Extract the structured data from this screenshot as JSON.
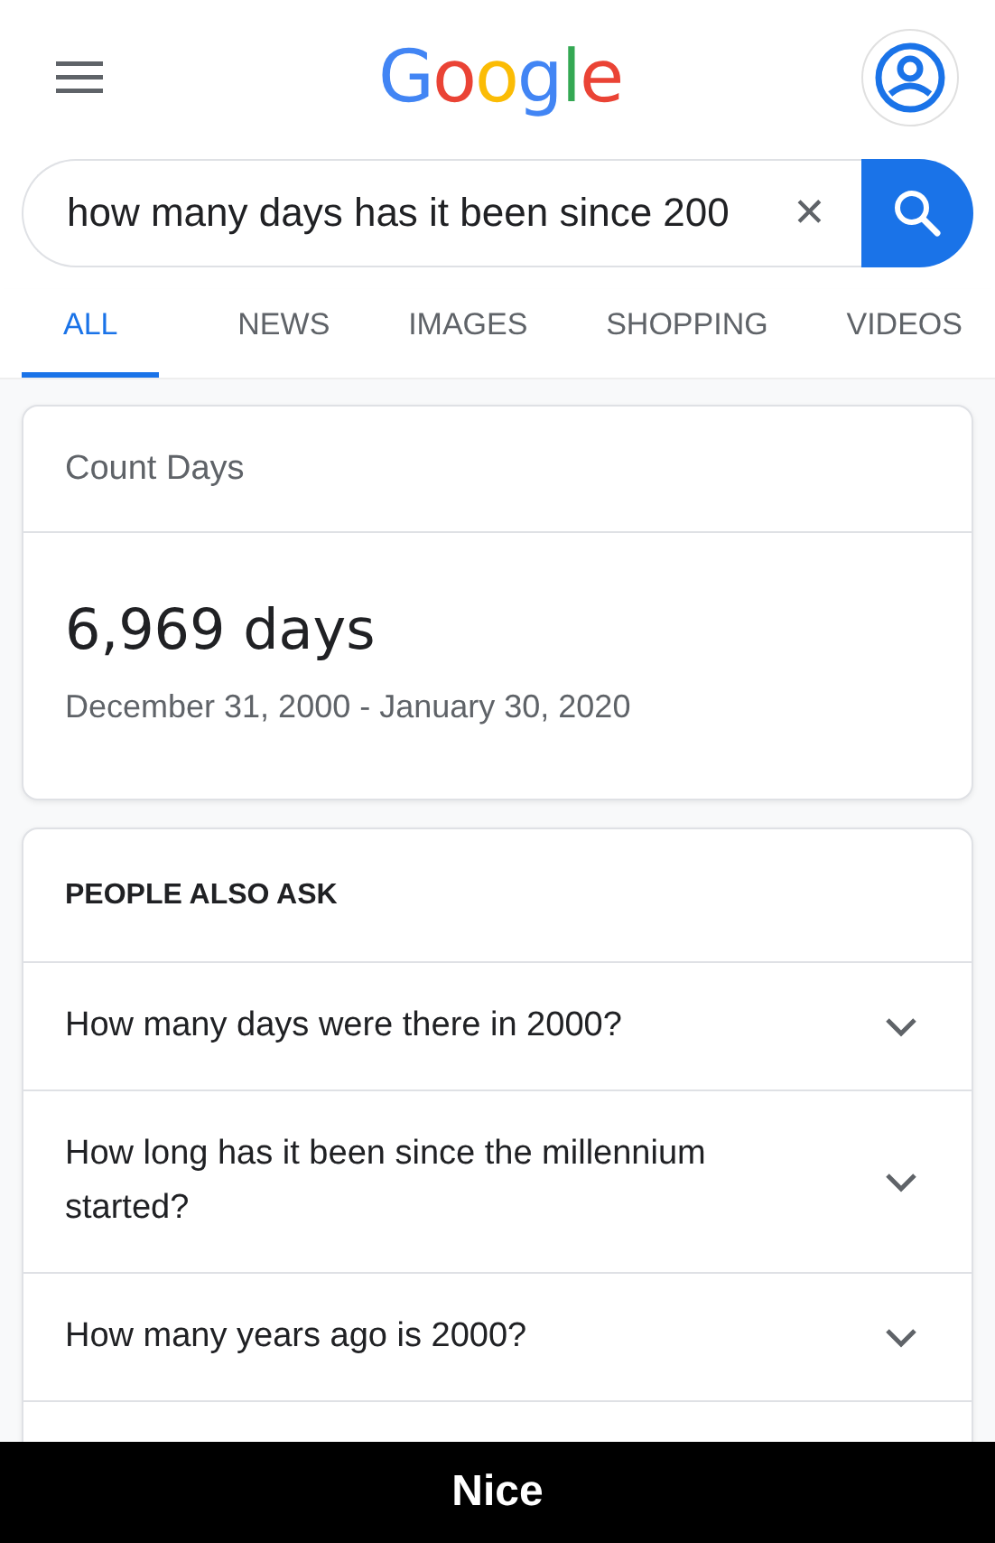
{
  "header": {
    "logo": "Google"
  },
  "search": {
    "value": "how many days has it been since 200",
    "clear": "✕"
  },
  "tabs": [
    {
      "label": "ALL",
      "selected": true
    },
    {
      "label": "NEWS",
      "selected": false
    },
    {
      "label": "IMAGES",
      "selected": false
    },
    {
      "label": "SHOPPING",
      "selected": false
    },
    {
      "label": "VIDEOS",
      "selected": false
    }
  ],
  "result_card": {
    "title": "Count Days",
    "value": "6,969 days",
    "range": "December 31, 2000 - January 30, 2020"
  },
  "people_also_ask": {
    "heading": "PEOPLE ALSO ASK",
    "questions": [
      {
        "text": "How many days were there in 2000?",
        "expanded": false
      },
      {
        "text": "How long has it been since the millennium started?",
        "expanded": false
      },
      {
        "text": "How many years ago is 2000?",
        "expanded": false
      }
    ]
  },
  "caption": "Nice"
}
